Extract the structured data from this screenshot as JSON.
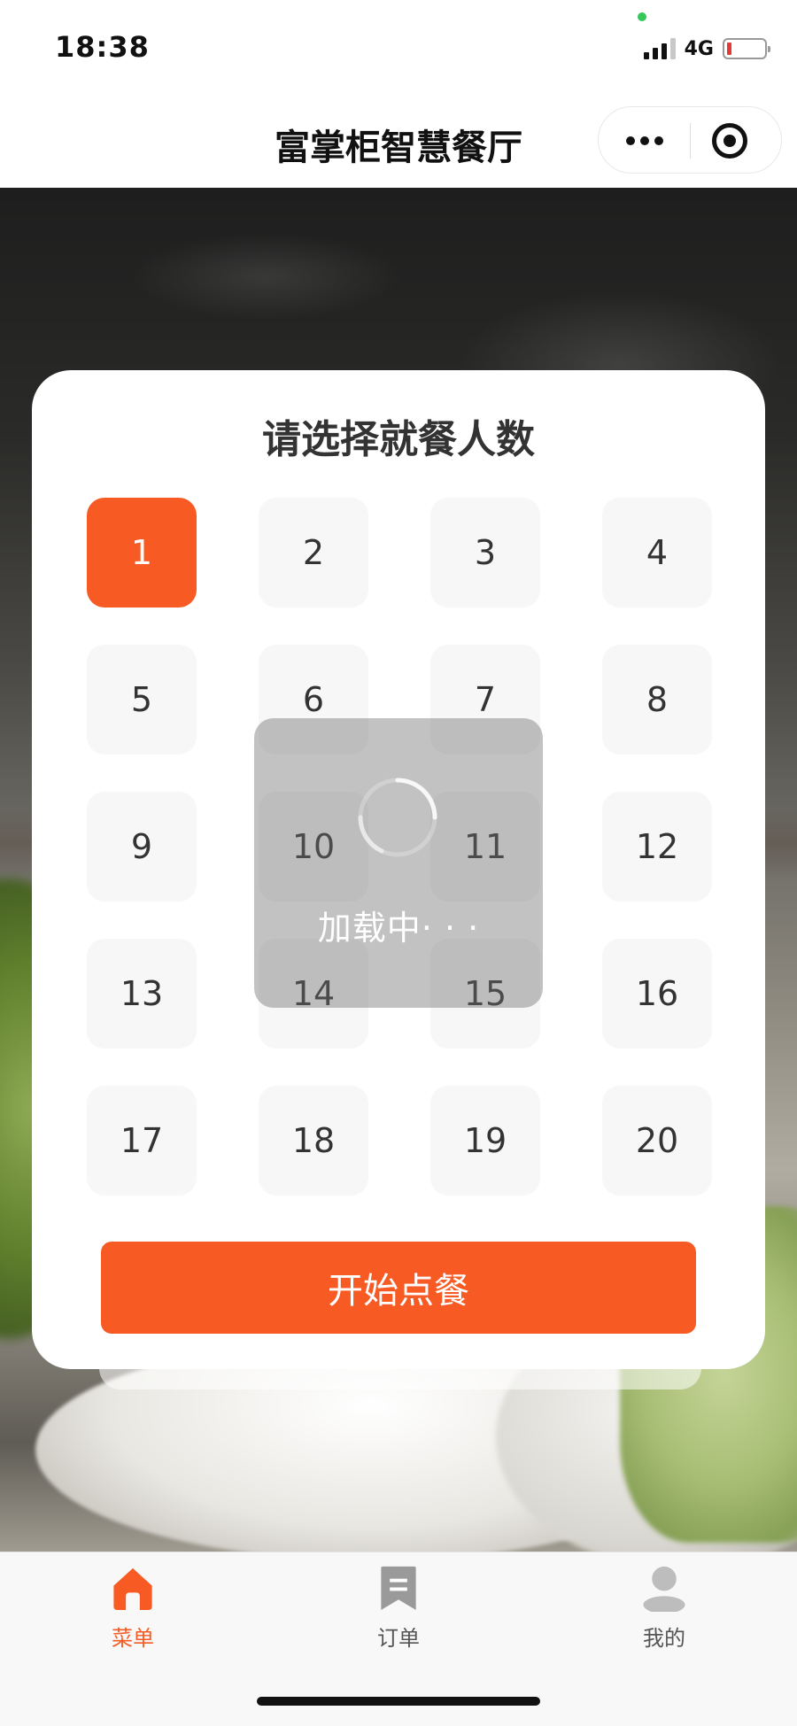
{
  "status_bar": {
    "time": "18:38",
    "network": "4G",
    "signal_icon": "signal-bars-icon",
    "battery_icon": "battery-low-icon",
    "battery_color": "#e53935"
  },
  "nav": {
    "title": "富掌柜智慧餐厅",
    "more_icon": "more-dots-icon",
    "close_icon": "target-close-icon"
  },
  "modal": {
    "title": "请选择就餐人数",
    "options": [
      "1",
      "2",
      "3",
      "4",
      "5",
      "6",
      "7",
      "8",
      "9",
      "10",
      "11",
      "12",
      "13",
      "14",
      "15",
      "16",
      "17",
      "18",
      "19",
      "20"
    ],
    "selected": "1",
    "start_button": "开始点餐",
    "accent_color": "#f85a24"
  },
  "loading": {
    "text": "加载中· · ·",
    "spinner_icon": "loading-spinner-icon"
  },
  "tab_bar": {
    "items": [
      {
        "label": "菜单",
        "icon": "home-icon",
        "active": true
      },
      {
        "label": "订单",
        "icon": "bookmark-order-icon",
        "active": false
      },
      {
        "label": "我的",
        "icon": "user-icon",
        "active": false
      }
    ]
  }
}
